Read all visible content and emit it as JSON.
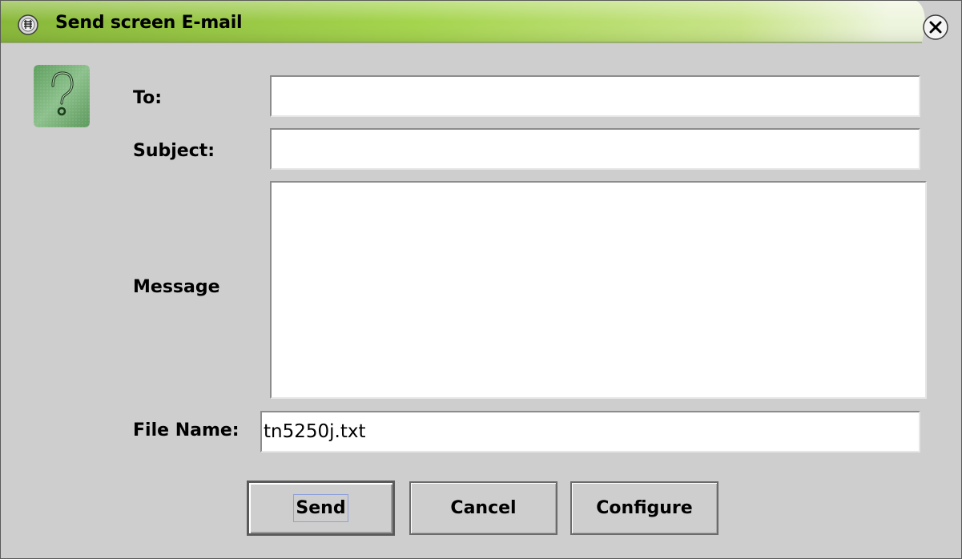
{
  "window": {
    "title": "Send screen E-mail"
  },
  "icons": {
    "app_icon": "app-menu-icon",
    "close_icon": "close-icon",
    "help_icon": "question-mark-icon"
  },
  "colors": {
    "titlebar_green": "#9ccc3c",
    "titlebar_fade": "#e8f2d2",
    "window_bg": "#cecece",
    "help_icon_green": "#6aa86a"
  },
  "form": {
    "to_label": "To:",
    "to_value": "",
    "subject_label": "Subject:",
    "subject_value": "",
    "message_label": "Message",
    "message_value": "",
    "filename_label": "File Name:",
    "filename_value": "tn5250j.txt"
  },
  "buttons": {
    "send": "Send",
    "cancel": "Cancel",
    "configure": "Configure"
  }
}
